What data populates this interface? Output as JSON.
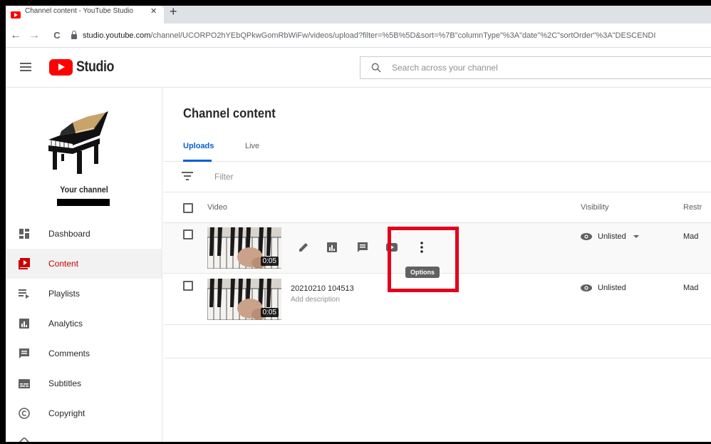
{
  "browser": {
    "tab_title": "Channel content - YouTube Studio",
    "tab_close": "✕",
    "new_tab": "+",
    "back": "←",
    "forward": "→",
    "reload": "C",
    "url_domain": "studio.youtube.com",
    "url_path": "/channel/UCORPO2hYEbQPkwGomRbWiFw/videos/upload?filter=%5B%5D&sort=%7B\"columnType\"%3A\"date\"%2C\"sortOrder\"%3A\"DESCENDI"
  },
  "header": {
    "logo_text": "Studio",
    "search_placeholder": "Search across your channel"
  },
  "sidebar": {
    "channel_label": "Your channel",
    "items": [
      {
        "label": "Dashboard",
        "icon": "dashboard-icon"
      },
      {
        "label": "Content",
        "icon": "content-icon",
        "active": true
      },
      {
        "label": "Playlists",
        "icon": "playlists-icon"
      },
      {
        "label": "Analytics",
        "icon": "analytics-icon"
      },
      {
        "label": "Comments",
        "icon": "comments-icon"
      },
      {
        "label": "Subtitles",
        "icon": "subtitles-icon"
      },
      {
        "label": "Copyright",
        "icon": "copyright-icon"
      }
    ]
  },
  "main": {
    "title": "Channel content",
    "tabs": [
      {
        "label": "Uploads",
        "active": true
      },
      {
        "label": "Live"
      }
    ],
    "filter_placeholder": "Filter",
    "columns": {
      "video": "Video",
      "visibility": "Visibility",
      "restrictions": "Restr"
    },
    "rows": [
      {
        "title": "",
        "description": "",
        "duration": "0:05",
        "visibility": "Unlisted",
        "restrictions": "Mad",
        "hover": true
      },
      {
        "title": "20210210 104513",
        "description": "Add description",
        "duration": "0:05",
        "visibility": "Unlisted",
        "restrictions": "Mad"
      }
    ],
    "tooltip": "Options"
  },
  "colors": {
    "accent_red": "#ff0000",
    "active_blue": "#065fd4",
    "highlight_box": "#e3001b"
  }
}
